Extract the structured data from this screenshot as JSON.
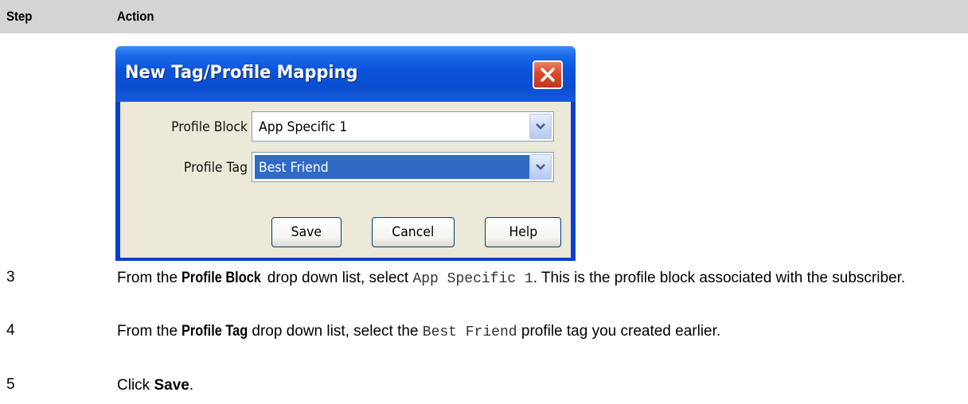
{
  "table_header": {
    "step": "Step",
    "action": "Action"
  },
  "dialog": {
    "title": "New Tag/Profile Mapping",
    "profile_block_label": "Profile Block",
    "profile_block_value": "App Specific 1",
    "profile_tag_label": "Profile Tag",
    "profile_tag_value": "Best Friend",
    "save_label": "Save",
    "cancel_label": "Cancel",
    "help_label": "Help",
    "icons": {
      "close": "close-icon",
      "dropdown": "chevron-down-icon"
    }
  },
  "steps": [
    {
      "number": "3",
      "pre": "From the ",
      "bold": "Profile Block",
      "mid": " drop down list, select ",
      "code": "App Specific 1",
      "post": ".  This is the profile block associated with the subscriber."
    },
    {
      "number": "4",
      "pre": "From the ",
      "bold": "Profile Tag",
      "mid": " drop down list, select the ",
      "code": "Best Friend",
      "post": " profile tag you created earlier."
    },
    {
      "number": "5",
      "pre": "Click ",
      "bold": "Save",
      "post": "."
    }
  ]
}
